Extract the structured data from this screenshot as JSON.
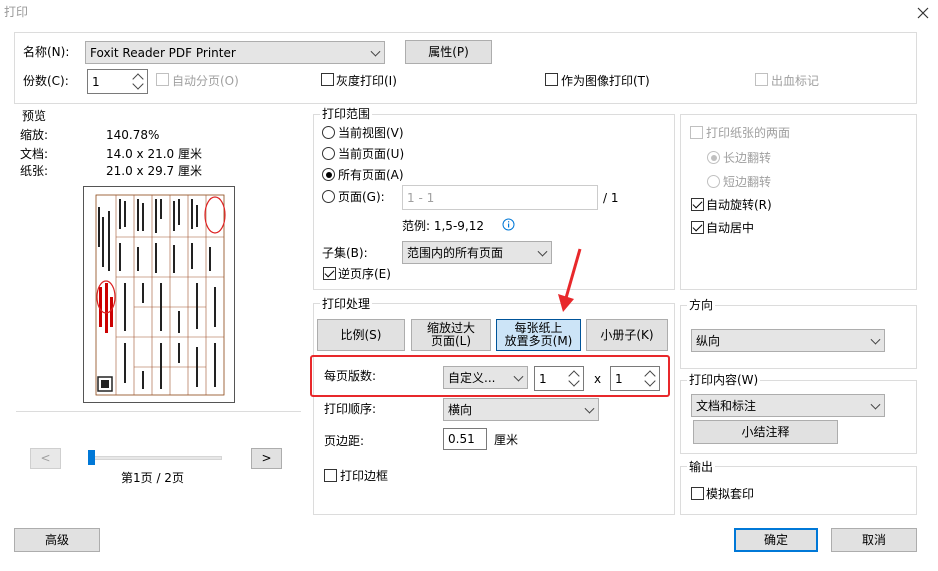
{
  "window": {
    "title": "打印"
  },
  "colors": {
    "accent": "#0078d7",
    "highlight": "#e8282b",
    "info": "#0078d7"
  },
  "printer": {
    "name_label": "名称(N):",
    "name_value": "Foxit Reader PDF Printer",
    "properties_button": "属性(P)",
    "copies_label": "份数(C):",
    "copies_value": "1",
    "collate_label": "自动分页(O)",
    "grayscale_label": "灰度打印(I)",
    "as_image_label": "作为图像打印(T)",
    "bleed_marks_label": "出血标记"
  },
  "preview": {
    "title": "预览",
    "zoom_label": "缩放:",
    "zoom_value": "140.78%",
    "document_label": "文档:",
    "document_value": "14.0 x 21.0 厘米",
    "paper_label": "纸张:",
    "paper_value": "21.0 x 29.7 厘米",
    "prev_button": "<",
    "next_button": ">",
    "page_indicator": "第1页 / 2页"
  },
  "range": {
    "title": "打印范围",
    "current_view": "当前视图(V)",
    "current_page": "当前页面(U)",
    "all_pages": "所有页面(A)",
    "pages_label": "页面(G):",
    "pages_placeholder": "1 - 1",
    "pages_total": "/ 1",
    "example": "范例: 1,5-9,12",
    "subset_label": "子集(B):",
    "subset_value": "范围内的所有页面",
    "reverse_label": "逆页序(E)"
  },
  "handling": {
    "title": "打印处理",
    "mode_scale": "比例(S)",
    "mode_shrink": "缩放过大\n页面(L)",
    "mode_multiple": "每张纸上\n放置多页(M)",
    "mode_booklet": "小册子(K)",
    "pages_per_sheet_label": "每页版数:",
    "pages_per_sheet_value": "自定义...",
    "cols": "1",
    "times": "x",
    "rows": "1",
    "order_label": "打印顺序:",
    "order_value": "横向",
    "margin_label": "页边距:",
    "margin_value": "0.51",
    "margin_unit": "厘米",
    "border_label": "打印边框"
  },
  "duplex": {
    "both_sides_label": "打印纸张的两面",
    "long_edge": "长边翻转",
    "short_edge": "短边翻转",
    "auto_rotate": "自动旋转(R)",
    "auto_center": "自动居中"
  },
  "orientation": {
    "title": "方向",
    "value": "纵向"
  },
  "content": {
    "title": "打印内容(W)",
    "value": "文档和标注",
    "summary_button": "小结注释"
  },
  "output": {
    "title": "输出",
    "simulate_label": "模拟套印"
  },
  "footer": {
    "advanced_button": "高级",
    "ok_button": "确定",
    "cancel_button": "取消"
  }
}
